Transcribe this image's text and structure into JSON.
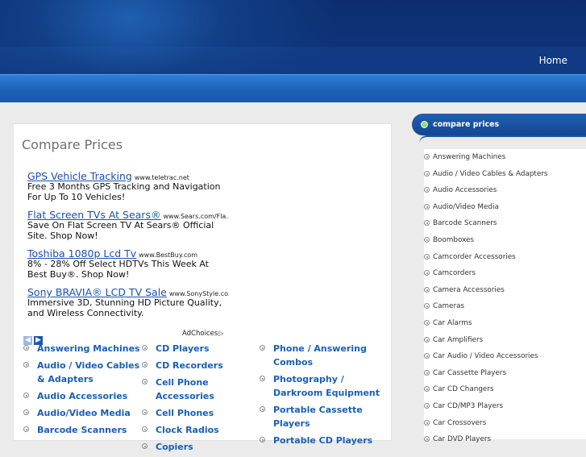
{
  "header": {
    "home_label": "Home"
  },
  "main": {
    "title": "Compare Prices",
    "ads": [
      {
        "title": "GPS Vehicle Tracking",
        "url": "www.teletrac.net",
        "desc": "Free 3 Months GPS Tracking and Navigation For Up To 10 Vehicles!"
      },
      {
        "title": "Flat Screen TVs At Sears®",
        "url": "www.Sears.com/Fla...",
        "desc": "Save On Flat Screen TV At Sears® Official Site. Shop Now!"
      },
      {
        "title": "Toshiba 1080p Lcd Tv",
        "url": "www.BestBuy.com",
        "desc": "8% - 28% Off Select HDTVs This Week At Best Buy®. Shop Now!"
      },
      {
        "title": "Sony BRAVIA® LCD TV Sale",
        "url": "www.SonyStyle.co...",
        "desc": "Immersive 3D, Stunning HD Picture Quality, and Wireless Connectivity."
      }
    ],
    "adchoices": "AdChoices",
    "categories": {
      "col1": [
        "Answering Machines",
        "Audio / Video Cables & Adapters",
        "Audio Accessories",
        "Audio/Video Media",
        "Barcode Scanners"
      ],
      "col2": [
        "CD Players",
        "CD Recorders",
        "Cell Phone Accessories",
        "Cell Phones",
        "Clock Radios",
        "Copiers"
      ],
      "col3": [
        "Phone / Answering Combos",
        "Photography / Darkroom Equipment",
        "Portable Cassette Players",
        "Portable CD Players"
      ]
    }
  },
  "sidebar": {
    "heading": "compare prices",
    "items": [
      "Answering Machines",
      "Audio / Video Cables & Adapters",
      "Audio Accessories",
      "Audio/Video Media",
      "Barcode Scanners",
      "Boomboxes",
      "Camcorder Accessories",
      "Camcorders",
      "Camera Accessories",
      "Cameras",
      "Car Alarms",
      "Car Amplifiers",
      "Car Audio / Video Accessories",
      "Car Cassette Players",
      "Car CD Changers",
      "Car CD/MP3 Players",
      "Car Crossovers",
      "Car DVD Players"
    ]
  }
}
